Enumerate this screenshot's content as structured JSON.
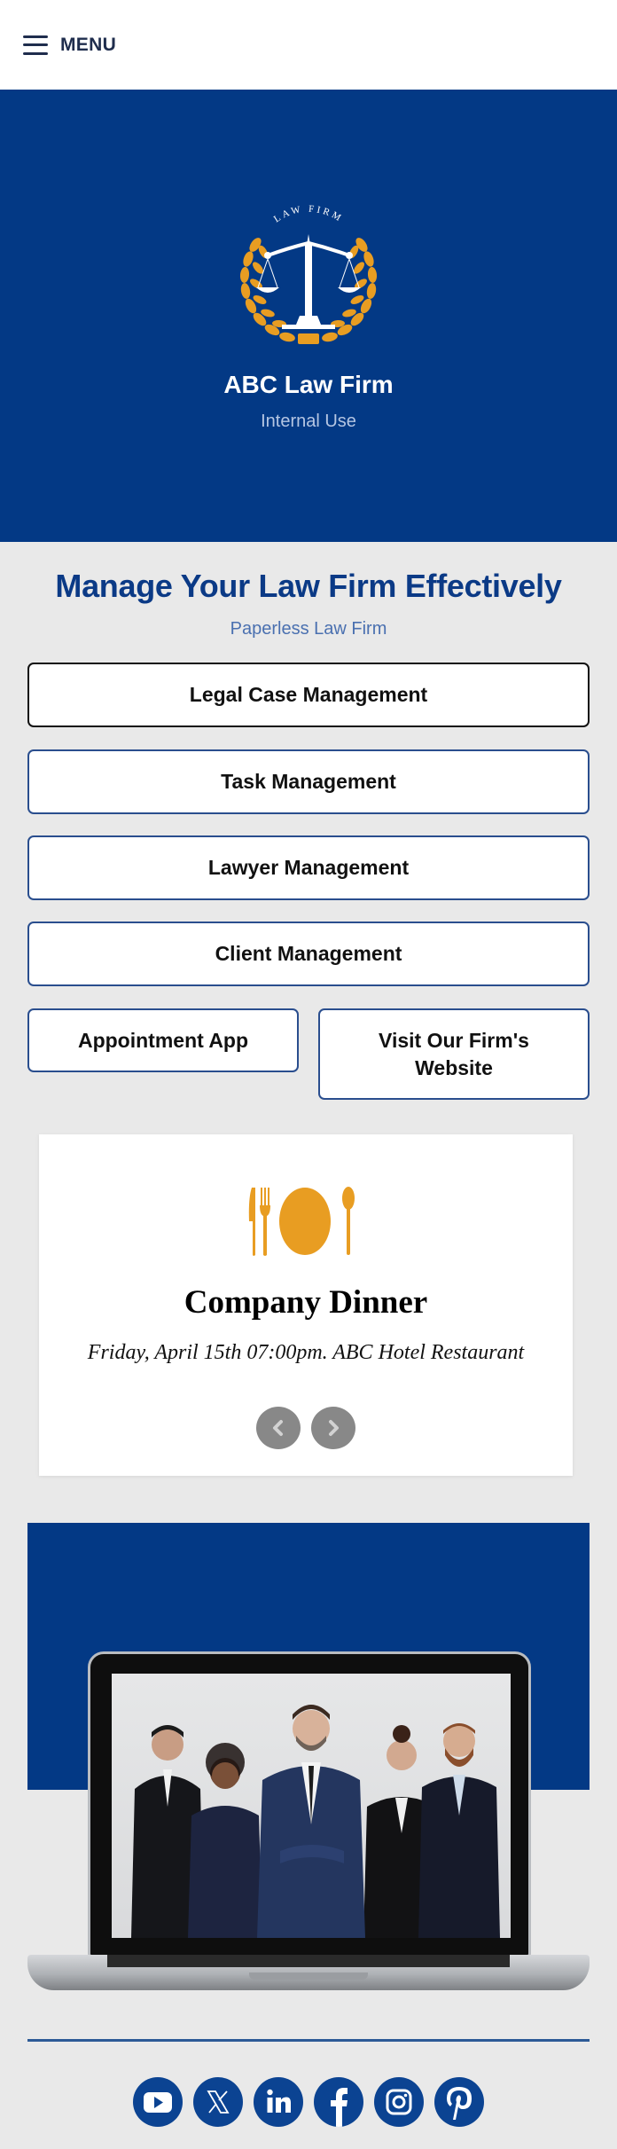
{
  "topbar": {
    "menu_label": "MENU",
    "menu_icon": "hamburger-icon"
  },
  "hero": {
    "logo_icon": "scales-of-justice-laurel-icon",
    "logo_text": "LAW FIRM",
    "title": "ABC Law Firm",
    "subtitle": "Internal Use"
  },
  "main": {
    "title": "Manage Your Law Firm Effectively",
    "subtitle": "Paperless Law Firm",
    "buttons": [
      {
        "label": "Legal Case Management"
      },
      {
        "label": "Task Management"
      },
      {
        "label": "Lawyer Management"
      },
      {
        "label": "Client Management"
      },
      {
        "label": "Appointment App"
      },
      {
        "label": "Visit Our Firm's Website"
      }
    ]
  },
  "event_card": {
    "icon": "dinner-plate-icon",
    "title": "Company Dinner",
    "description": "Friday, April 15th 07:00pm. ABC Hotel Restaurant",
    "prev_icon": "chevron-left-icon",
    "next_icon": "chevron-right-icon"
  },
  "promo": {
    "image": "laptop-team-photo",
    "image_alt": "Team of five business professionals on a laptop screen"
  },
  "social": [
    {
      "name": "YouTube",
      "icon": "youtube-icon"
    },
    {
      "name": "X",
      "icon": "x-icon"
    },
    {
      "name": "LinkedIn",
      "icon": "linkedin-icon"
    },
    {
      "name": "Facebook",
      "icon": "facebook-icon"
    },
    {
      "name": "Instagram",
      "icon": "instagram-icon"
    },
    {
      "name": "Pinterest",
      "icon": "pinterest-icon"
    }
  ],
  "colors": {
    "brand_blue": "#033985",
    "accent_gold": "#e89d22",
    "page_bg": "#e9e9e9",
    "social_blue": "#0b4392"
  }
}
